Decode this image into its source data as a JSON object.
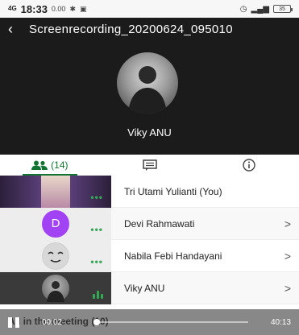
{
  "status_bar": {
    "network": "4G",
    "time": "18:33",
    "speed": "0.00",
    "battery": "35"
  },
  "header": {
    "title": "Screenrecording_20200624_095010",
    "presenter_name": "Viky ANU"
  },
  "tabs": [
    {
      "label": "(14)",
      "icon": "people-icon",
      "active": true
    },
    {
      "label": "",
      "icon": "chat-icon",
      "active": false
    },
    {
      "label": "",
      "icon": "info-icon",
      "active": false
    }
  ],
  "participants": [
    {
      "name": "Tri Utami Yulianti (You)",
      "indicator": "dots",
      "tile": "photo",
      "has_chevron": false
    },
    {
      "name": "Devi Rahmawati",
      "initial": "D",
      "avatar_color": "#a142f4",
      "indicator": "dots",
      "tile": "initial",
      "has_chevron": true
    },
    {
      "name": "Nabila Febi Handayani",
      "indicator": "dots",
      "tile": "photo",
      "has_chevron": true
    },
    {
      "name": "Viky ANU",
      "indicator": "audio",
      "tile": "photo",
      "has_chevron": true
    }
  ],
  "footer": {
    "label": "All in the meeting (10)"
  },
  "player": {
    "elapsed": "00:02",
    "duration": "40:13",
    "progress_fraction": 0.01
  },
  "colors": {
    "accent": "#137333",
    "speaking": "#34a853",
    "header_bg": "#1b1b1b"
  }
}
